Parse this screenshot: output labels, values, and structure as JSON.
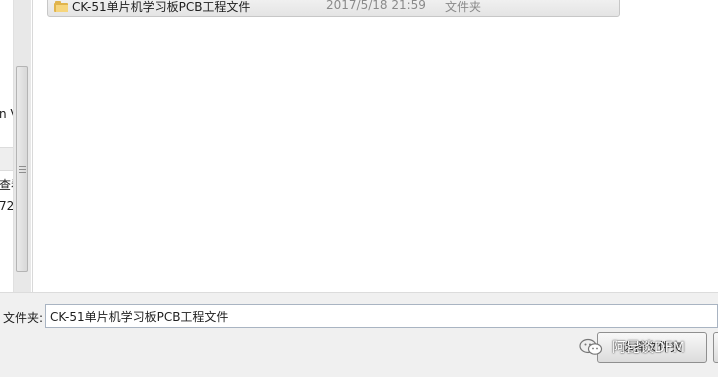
{
  "left_pane": {
    "fragments": [
      "n V",
      "查看",
      "72."
    ]
  },
  "file_list": {
    "rows": [
      {
        "name": "CK-51单片机学习板PCB工程文件",
        "date": "2017/5/18 21:59",
        "type": "文件夹",
        "icon": "folder-icon"
      }
    ]
  },
  "bottom_bar": {
    "folder_label": "文件夹:",
    "folder_value": "CK-51单片机学习板PCB工程文件",
    "select_button_label": "选择文件夹"
  },
  "watermark": {
    "text": "阿昆谈DFM",
    "icon": "wechat-icon"
  },
  "colors": {
    "row_border": "#c7c7c7",
    "folder_yellow": "#e0b44c",
    "date_gray": "#8a8a8a",
    "input_border": "#a9b4c2"
  }
}
